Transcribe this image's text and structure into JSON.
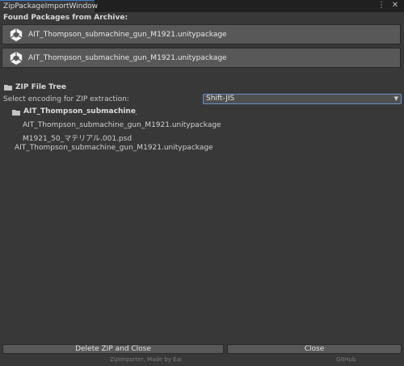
{
  "window": {
    "tab_title": "ZipPackageImportWindow",
    "menu_glyph": "⋮",
    "close_glyph": "✕"
  },
  "found_packages": {
    "header": "Found Packages from Archive:",
    "items": [
      {
        "label": "AIT_Thompson_submachine_gun_M1921.unitypackage",
        "icon": "unity-icon"
      },
      {
        "label": "AIT_Thompson_submachine_gun_M1921.unitypackage",
        "icon": "unity-icon"
      }
    ]
  },
  "zip_tree": {
    "title": "ZIP File Tree",
    "encoding_label": "Select encoding for ZIP extraction:",
    "encoding_value": "Shift-JIS",
    "root_folder": "AIT_Thompson_submachine_gun_M",
    "children": [
      "AIT_Thompson_submachine_gun_M1921.unitypackage",
      "M1921_50_マテリアル.001.psd"
    ],
    "top_level_file": "AIT_Thompson_submachine_gun_M1921.unitypackage"
  },
  "actions": {
    "delete_close_label": "Delete ZIP and Close",
    "close_label": "Close"
  },
  "footer": {
    "credit": "ZipImporter, Made by Eai",
    "github": "GitHub"
  },
  "colors": {
    "background": "#383838",
    "tab_bar": "#202020",
    "button": "#585858",
    "select_border": "#6a8fc9"
  }
}
